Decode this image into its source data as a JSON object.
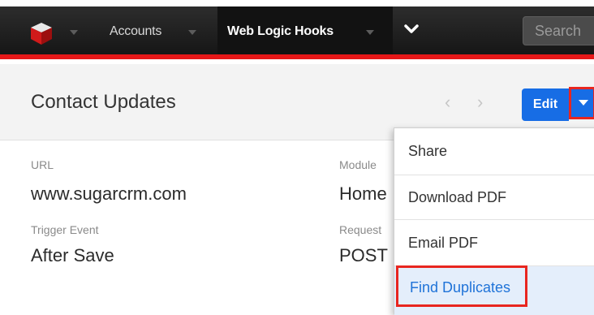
{
  "nav": {
    "modules": [
      {
        "label": "Accounts",
        "active": false
      },
      {
        "label": "Web Logic Hooks",
        "active": true
      }
    ],
    "more_icon": "chevron-down-icon",
    "search_placeholder": "Search"
  },
  "record": {
    "title": "Contact Updates",
    "edit_label": "Edit",
    "pager": {
      "prev": "‹",
      "next": "›"
    }
  },
  "fields": [
    {
      "label": "URL",
      "value": "www.sugarcrm.com"
    },
    {
      "label": "Module",
      "value": "Home"
    },
    {
      "label": "Trigger Event",
      "value": "After Save"
    },
    {
      "label": "Request",
      "value": "POST"
    }
  ],
  "actions_menu": [
    {
      "label": "Share"
    },
    {
      "label": "Download PDF"
    },
    {
      "label": "Email PDF"
    },
    {
      "label": "Find Duplicates",
      "highlighted": true
    }
  ],
  "colors": {
    "navbar": "#1e1e1e",
    "accent_red": "#e61718",
    "primary_button": "#176de5",
    "link_blue": "#1f73d8"
  }
}
